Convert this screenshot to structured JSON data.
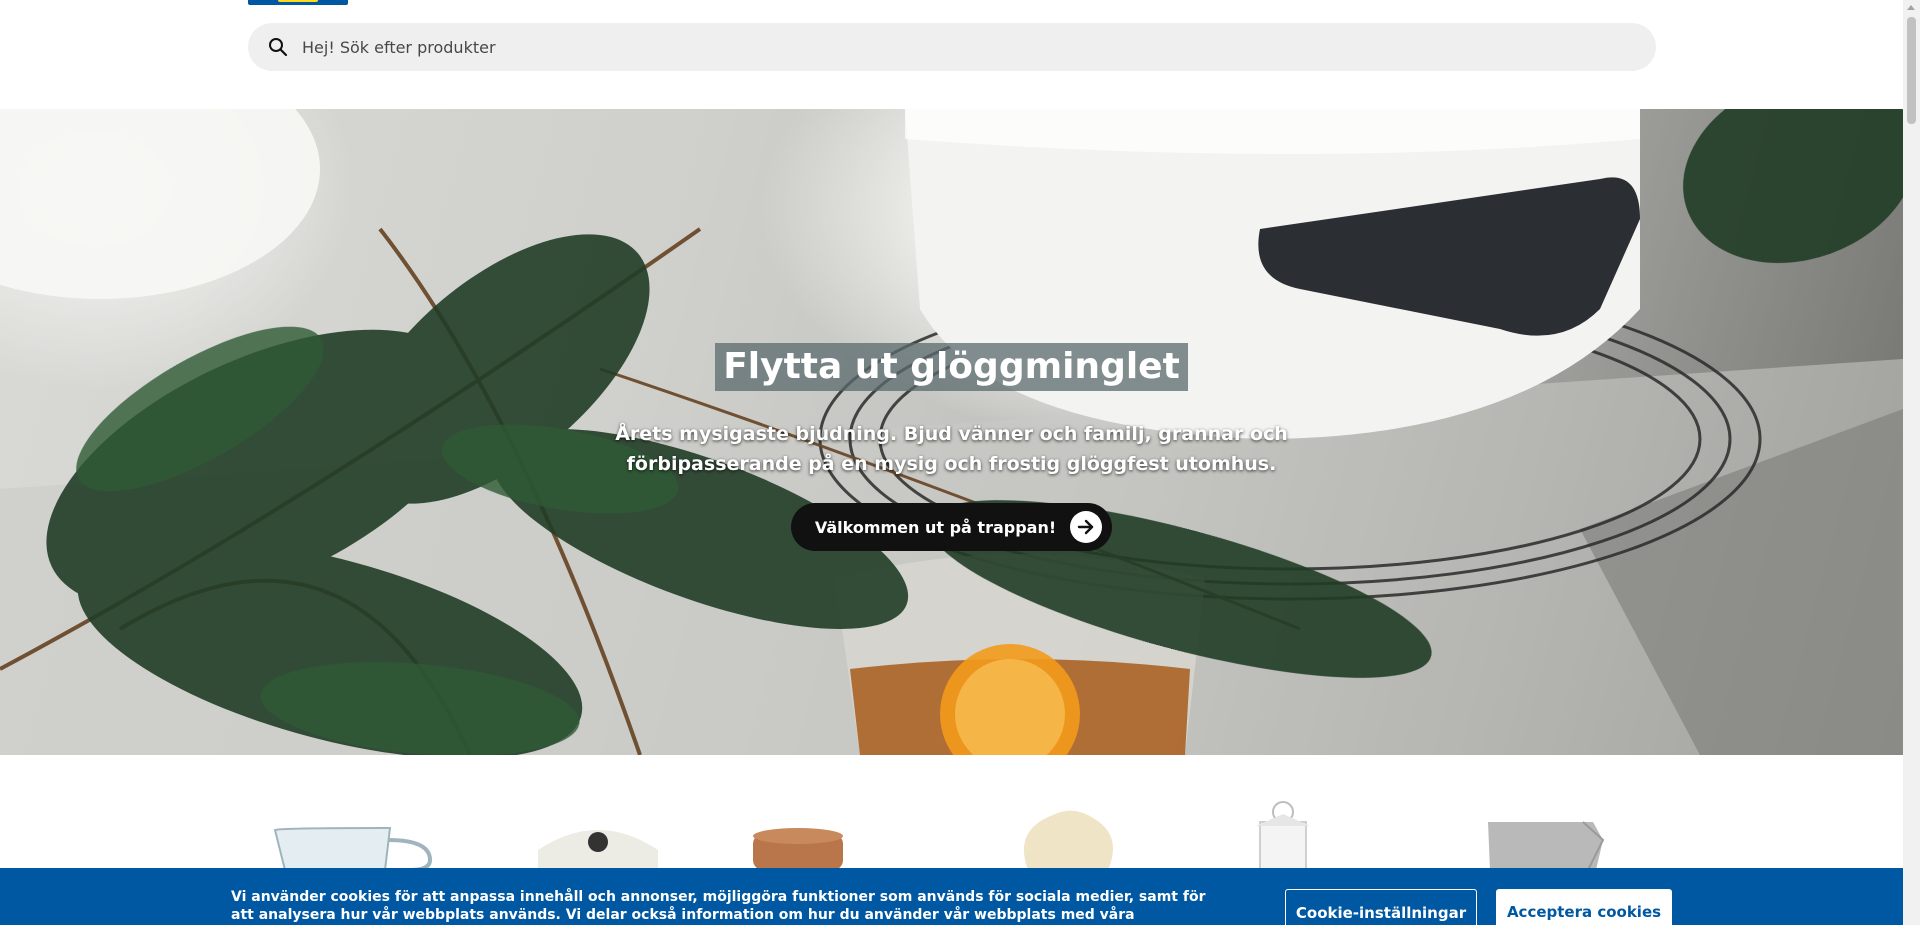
{
  "search": {
    "placeholder": "Hej! Sök efter produkter",
    "icon": "search-icon"
  },
  "hero": {
    "title": "Flytta ut glöggminglet",
    "text": "Årets mysigaste bjudning. Bjud vänner och familj, grannar och förbipasserande på en mysig och frostig glöggfest utomhus.",
    "button_label": "Välkommen ut på trappan!",
    "button_icon": "arrow-right-icon"
  },
  "products": [
    {
      "name": "glass-mug"
    },
    {
      "name": "casserole-pot"
    },
    {
      "name": "cork-jar"
    },
    {
      "name": "sheepskin"
    },
    {
      "name": "lantern"
    },
    {
      "name": "grey-throw"
    }
  ],
  "cookie": {
    "text": "Vi använder cookies för att anpassa innehåll och annonser, möjliggöra funktioner som används för sociala medier, samt för att analysera hur vår webbplats används. Vi delar också information om hur du använder vår webbplats med våra samarbetspartners för sociala medier, annonsering och",
    "settings_label": "Cookie-inställningar",
    "accept_label": "Acceptera cookies"
  },
  "colors": {
    "brand_blue": "#0058a3",
    "brand_yellow": "#ffda1a",
    "search_bg": "#efefef"
  }
}
